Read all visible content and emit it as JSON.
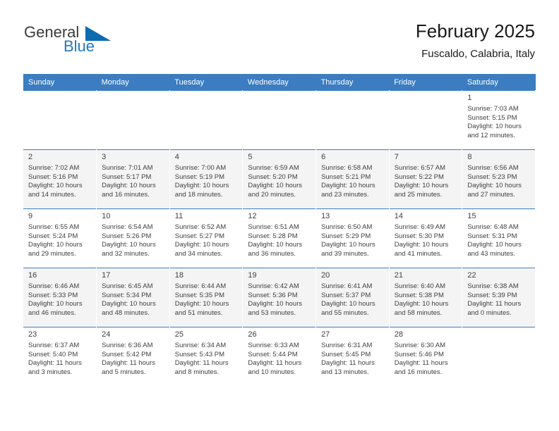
{
  "brand": {
    "name_part1": "General",
    "name_part2": "Blue",
    "triangle_color": "#0d6bb0",
    "text_color": "#3b3b3b",
    "blue_color": "#2079c7"
  },
  "header": {
    "title": "February 2025",
    "subtitle": "Fuscaldo, Calabria, Italy"
  },
  "theme": {
    "header_bg": "#3b7dc0",
    "header_text": "#ffffff",
    "shaded_row_bg": "#f4f4f4",
    "cell_text": "#3f3f3f"
  },
  "weekdays": [
    "Sunday",
    "Monday",
    "Tuesday",
    "Wednesday",
    "Thursday",
    "Friday",
    "Saturday"
  ],
  "weeks": [
    {
      "shaded": false,
      "days": [
        {
          "num": "",
          "sunrise": "",
          "sunset": "",
          "daylight1": "",
          "daylight2": ""
        },
        {
          "num": "",
          "sunrise": "",
          "sunset": "",
          "daylight1": "",
          "daylight2": ""
        },
        {
          "num": "",
          "sunrise": "",
          "sunset": "",
          "daylight1": "",
          "daylight2": ""
        },
        {
          "num": "",
          "sunrise": "",
          "sunset": "",
          "daylight1": "",
          "daylight2": ""
        },
        {
          "num": "",
          "sunrise": "",
          "sunset": "",
          "daylight1": "",
          "daylight2": ""
        },
        {
          "num": "",
          "sunrise": "",
          "sunset": "",
          "daylight1": "",
          "daylight2": ""
        },
        {
          "num": "1",
          "sunrise": "Sunrise: 7:03 AM",
          "sunset": "Sunset: 5:15 PM",
          "daylight1": "Daylight: 10 hours",
          "daylight2": "and 12 minutes."
        }
      ]
    },
    {
      "shaded": true,
      "days": [
        {
          "num": "2",
          "sunrise": "Sunrise: 7:02 AM",
          "sunset": "Sunset: 5:16 PM",
          "daylight1": "Daylight: 10 hours",
          "daylight2": "and 14 minutes."
        },
        {
          "num": "3",
          "sunrise": "Sunrise: 7:01 AM",
          "sunset": "Sunset: 5:17 PM",
          "daylight1": "Daylight: 10 hours",
          "daylight2": "and 16 minutes."
        },
        {
          "num": "4",
          "sunrise": "Sunrise: 7:00 AM",
          "sunset": "Sunset: 5:19 PM",
          "daylight1": "Daylight: 10 hours",
          "daylight2": "and 18 minutes."
        },
        {
          "num": "5",
          "sunrise": "Sunrise: 6:59 AM",
          "sunset": "Sunset: 5:20 PM",
          "daylight1": "Daylight: 10 hours",
          "daylight2": "and 20 minutes."
        },
        {
          "num": "6",
          "sunrise": "Sunrise: 6:58 AM",
          "sunset": "Sunset: 5:21 PM",
          "daylight1": "Daylight: 10 hours",
          "daylight2": "and 23 minutes."
        },
        {
          "num": "7",
          "sunrise": "Sunrise: 6:57 AM",
          "sunset": "Sunset: 5:22 PM",
          "daylight1": "Daylight: 10 hours",
          "daylight2": "and 25 minutes."
        },
        {
          "num": "8",
          "sunrise": "Sunrise: 6:56 AM",
          "sunset": "Sunset: 5:23 PM",
          "daylight1": "Daylight: 10 hours",
          "daylight2": "and 27 minutes."
        }
      ]
    },
    {
      "shaded": false,
      "days": [
        {
          "num": "9",
          "sunrise": "Sunrise: 6:55 AM",
          "sunset": "Sunset: 5:24 PM",
          "daylight1": "Daylight: 10 hours",
          "daylight2": "and 29 minutes."
        },
        {
          "num": "10",
          "sunrise": "Sunrise: 6:54 AM",
          "sunset": "Sunset: 5:26 PM",
          "daylight1": "Daylight: 10 hours",
          "daylight2": "and 32 minutes."
        },
        {
          "num": "11",
          "sunrise": "Sunrise: 6:52 AM",
          "sunset": "Sunset: 5:27 PM",
          "daylight1": "Daylight: 10 hours",
          "daylight2": "and 34 minutes."
        },
        {
          "num": "12",
          "sunrise": "Sunrise: 6:51 AM",
          "sunset": "Sunset: 5:28 PM",
          "daylight1": "Daylight: 10 hours",
          "daylight2": "and 36 minutes."
        },
        {
          "num": "13",
          "sunrise": "Sunrise: 6:50 AM",
          "sunset": "Sunset: 5:29 PM",
          "daylight1": "Daylight: 10 hours",
          "daylight2": "and 39 minutes."
        },
        {
          "num": "14",
          "sunrise": "Sunrise: 6:49 AM",
          "sunset": "Sunset: 5:30 PM",
          "daylight1": "Daylight: 10 hours",
          "daylight2": "and 41 minutes."
        },
        {
          "num": "15",
          "sunrise": "Sunrise: 6:48 AM",
          "sunset": "Sunset: 5:31 PM",
          "daylight1": "Daylight: 10 hours",
          "daylight2": "and 43 minutes."
        }
      ]
    },
    {
      "shaded": true,
      "days": [
        {
          "num": "16",
          "sunrise": "Sunrise: 6:46 AM",
          "sunset": "Sunset: 5:33 PM",
          "daylight1": "Daylight: 10 hours",
          "daylight2": "and 46 minutes."
        },
        {
          "num": "17",
          "sunrise": "Sunrise: 6:45 AM",
          "sunset": "Sunset: 5:34 PM",
          "daylight1": "Daylight: 10 hours",
          "daylight2": "and 48 minutes."
        },
        {
          "num": "18",
          "sunrise": "Sunrise: 6:44 AM",
          "sunset": "Sunset: 5:35 PM",
          "daylight1": "Daylight: 10 hours",
          "daylight2": "and 51 minutes."
        },
        {
          "num": "19",
          "sunrise": "Sunrise: 6:42 AM",
          "sunset": "Sunset: 5:36 PM",
          "daylight1": "Daylight: 10 hours",
          "daylight2": "and 53 minutes."
        },
        {
          "num": "20",
          "sunrise": "Sunrise: 6:41 AM",
          "sunset": "Sunset: 5:37 PM",
          "daylight1": "Daylight: 10 hours",
          "daylight2": "and 55 minutes."
        },
        {
          "num": "21",
          "sunrise": "Sunrise: 6:40 AM",
          "sunset": "Sunset: 5:38 PM",
          "daylight1": "Daylight: 10 hours",
          "daylight2": "and 58 minutes."
        },
        {
          "num": "22",
          "sunrise": "Sunrise: 6:38 AM",
          "sunset": "Sunset: 5:39 PM",
          "daylight1": "Daylight: 11 hours",
          "daylight2": "and 0 minutes."
        }
      ]
    },
    {
      "shaded": false,
      "days": [
        {
          "num": "23",
          "sunrise": "Sunrise: 6:37 AM",
          "sunset": "Sunset: 5:40 PM",
          "daylight1": "Daylight: 11 hours",
          "daylight2": "and 3 minutes."
        },
        {
          "num": "24",
          "sunrise": "Sunrise: 6:36 AM",
          "sunset": "Sunset: 5:42 PM",
          "daylight1": "Daylight: 11 hours",
          "daylight2": "and 5 minutes."
        },
        {
          "num": "25",
          "sunrise": "Sunrise: 6:34 AM",
          "sunset": "Sunset: 5:43 PM",
          "daylight1": "Daylight: 11 hours",
          "daylight2": "and 8 minutes."
        },
        {
          "num": "26",
          "sunrise": "Sunrise: 6:33 AM",
          "sunset": "Sunset: 5:44 PM",
          "daylight1": "Daylight: 11 hours",
          "daylight2": "and 10 minutes."
        },
        {
          "num": "27",
          "sunrise": "Sunrise: 6:31 AM",
          "sunset": "Sunset: 5:45 PM",
          "daylight1": "Daylight: 11 hours",
          "daylight2": "and 13 minutes."
        },
        {
          "num": "28",
          "sunrise": "Sunrise: 6:30 AM",
          "sunset": "Sunset: 5:46 PM",
          "daylight1": "Daylight: 11 hours",
          "daylight2": "and 16 minutes."
        },
        {
          "num": "",
          "sunrise": "",
          "sunset": "",
          "daylight1": "",
          "daylight2": ""
        }
      ]
    }
  ]
}
